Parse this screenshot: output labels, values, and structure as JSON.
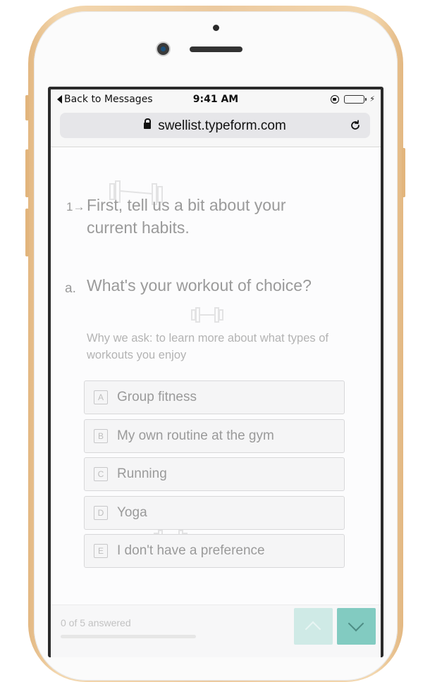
{
  "status_bar": {
    "back_label": "Back to Messages",
    "time": "9:41 AM"
  },
  "browser": {
    "url": "swellist.typeform.com"
  },
  "form": {
    "question_number": "1→",
    "question_title": "First, tell us a bit about your current habits.",
    "sub_number": "a.",
    "sub_title": "What's your workout of choice?",
    "sub_description": "Why we ask: to learn more about what types of workouts you enjoy",
    "choices": [
      {
        "key": "A",
        "label": "Group fitness"
      },
      {
        "key": "B",
        "label": "My own routine at the gym"
      },
      {
        "key": "C",
        "label": "Running"
      },
      {
        "key": "D",
        "label": "Yoga"
      },
      {
        "key": "E",
        "label": "I don't have a preference"
      }
    ]
  },
  "footer": {
    "progress_text": "0 of 5 answered",
    "progress_fraction": 0
  },
  "icons": {
    "back": "back-triangle-icon",
    "lock": "lock-icon",
    "reload": "reload-icon",
    "rotation_lock": "rotation-lock-icon",
    "battery": "battery-icon",
    "charging": "charging-bolt-icon",
    "dumbbell": "dumbbell-icon",
    "nav_up": "chevron-up-icon",
    "nav_down": "chevron-down-icon"
  },
  "colors": {
    "phone_frame": "#e9c391",
    "battery_fill": "#4cd964",
    "nav_down_bg": "#82cbc1",
    "nav_up_bg": "#cfeae6",
    "text_muted": "#9a9a9a"
  }
}
